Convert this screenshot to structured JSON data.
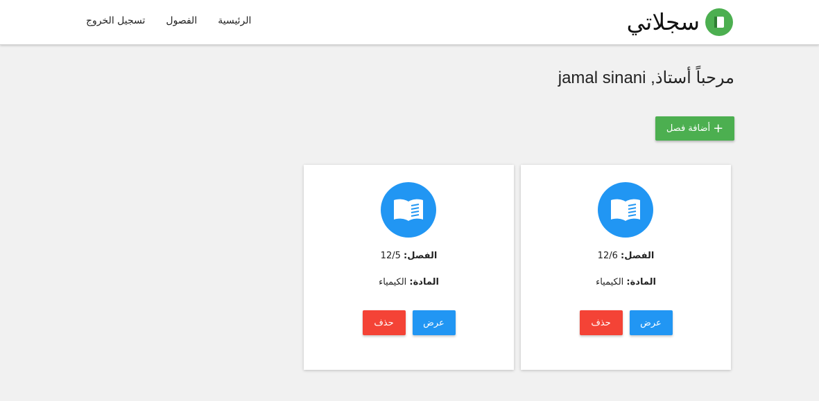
{
  "brand": {
    "name": "سجلاتي",
    "logo_icon": "notebook-icon",
    "color": "#4caf50"
  },
  "nav": {
    "items": [
      "الرئيسية",
      "الفصول",
      "تسجيل الخروج"
    ]
  },
  "welcome": "مرحباً أستاذ, jamal sinani",
  "add_button": {
    "icon": "+",
    "label": "أضافة فصل",
    "color": "#4caf50"
  },
  "cards": [
    {
      "icon": "open-book-icon",
      "class_label": "الفصل:",
      "class_value": "12/6",
      "subject_label": "المادة:",
      "subject_value": "الكيمياء",
      "view_label": "عرض",
      "delete_label": "حذف"
    },
    {
      "icon": "open-book-icon",
      "class_label": "الفصل:",
      "class_value": "12/5",
      "subject_label": "المادة:",
      "subject_value": "الكيمياء",
      "view_label": "عرض",
      "delete_label": "حذف"
    }
  ],
  "colors": {
    "primary": "#2196f3",
    "danger": "#f44336",
    "success": "#4caf50",
    "background": "#f1f1f1"
  }
}
